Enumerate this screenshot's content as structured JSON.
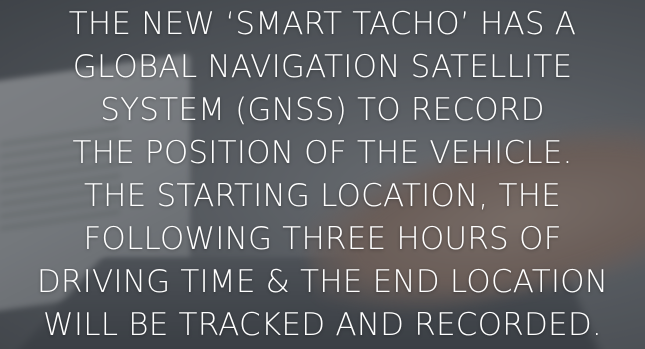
{
  "caption": {
    "lines": [
      "THE NEW ‘SMART TACHO’ HAS A",
      "GLOBAL NAVIGATION SATELLITE",
      "SYSTEM (GNSS) TO RECORD",
      "THE POSITION OF THE VEHICLE.",
      "THE STARTING LOCATION, THE",
      "FOLLOWING THREE HOURS OF",
      "DRIVING TIME & THE END LOCATION",
      "WILL BE TRACKED AND RECORDED."
    ]
  },
  "colors": {
    "text": "#ffffff",
    "overlay": "#282c32"
  }
}
